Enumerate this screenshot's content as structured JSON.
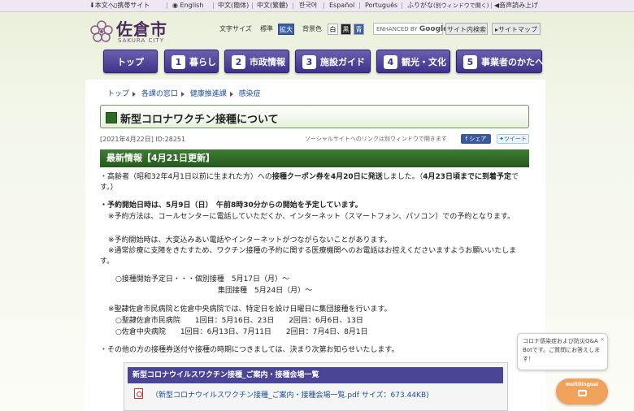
{
  "utility_bar": {
    "items": [
      "本文へ",
      "携帯サイト",
      "English",
      "中文(簡体)",
      "中文(繁體)",
      "한국어",
      "Español",
      "Português",
      "ふりがな",
      "(別ウィンドウで開く)",
      "音声読み上げ"
    ]
  },
  "header": {
    "logo_name": "佐倉市",
    "logo_sub": "SAKURA CITY",
    "text_size_label": "文字サイズ",
    "text_size_options": [
      "標準",
      "拡大"
    ],
    "bg_color_label": "背景色",
    "bg_color_options": [
      "白",
      "黒",
      "青"
    ],
    "search_placeholder_prefix": "ENHANCED BY",
    "search_placeholder_brand": "Google",
    "site_search_button": "サイト内検索",
    "sitemap_button": "サイトマップ"
  },
  "nav": [
    {
      "num": "",
      "label": "トップ"
    },
    {
      "num": "1",
      "label": "暮らし"
    },
    {
      "num": "2",
      "label": "市政情報"
    },
    {
      "num": "3",
      "label": "施設ガイド"
    },
    {
      "num": "4",
      "label": "観光・文化"
    },
    {
      "num": "5",
      "label": "事業者のかたへ"
    }
  ],
  "breadcrumb": [
    "トップ",
    "各課の窓口",
    "健康推進課",
    "感染症"
  ],
  "page": {
    "title": "新型コロナワクチン接種について",
    "date": "[2021年4月22日]",
    "id": "ID:28251",
    "social_note": "ソーシャルサイトへのリンクは別ウィンドウで開きます",
    "share_label": "シェア",
    "tweet_label": "ツイート",
    "section_title": "最新情報【4月21日更新】",
    "para1_a": "・高齢者（昭和32年4月1日以前に生まれた方）への",
    "para1_b": "接種クーポン券を4月20日に発送",
    "para1_c": "しました。（",
    "para1_d": "4月23日頃までに到着予定",
    "para1_e": "です。）",
    "para2": "・予約開始日時は、5月9日（日）　午前8時30分からの開始を予定しています。",
    "para3": "※予約方法は、コールセンターに電話していただくか、インターネット（スマートフォン、パソコン）での予約となります。",
    "para4": "※予約開始時は、大変込みあい電話やインターネットがつながらないことがあります。",
    "para5": "※通常診療に支障をきたすため、ワクチン接種の予約に関する医療機関へのお電話はお控えくださいますようお願いいたします。",
    "schedule1": "○接種開始予定日・・・個別接種　5月17日（月）～",
    "schedule2": "集団接種　5月24日（月）～",
    "group1": "※聖隷佐倉市民病院と佐倉中央病院では、特定日を設け日曜日に集団接種を行います。",
    "group2": "○聖隷佐倉市民病院　　1回目：5月16日、23日　　2回目：6月6日、13日",
    "group3": "○佐倉中央病院　　1回目：6月13日、7月11日　　2回目：7月4日、8月1日",
    "para6": "・その他の方の接種券送付や接種の時期につきましては、決まり次第お知らせいたします。",
    "attachment_title": "新型コロナウイルスワクチン接種_ご案内・接種会場一覧",
    "attachment_link": "（新型コロナウイルスワクチン接種_ご案内・接種会場一覧.pdf サイズ：673.44KB)"
  },
  "chatbot": {
    "bubble_text": "コロナ感染症および防災Q&A Botです。ご質問にお答えします！",
    "close_label": "×",
    "button_label": "multilingual"
  },
  "colors": {
    "nav": "#4a3f9a",
    "heading_green": "#2f6b25",
    "link": "#1a4f9c"
  }
}
